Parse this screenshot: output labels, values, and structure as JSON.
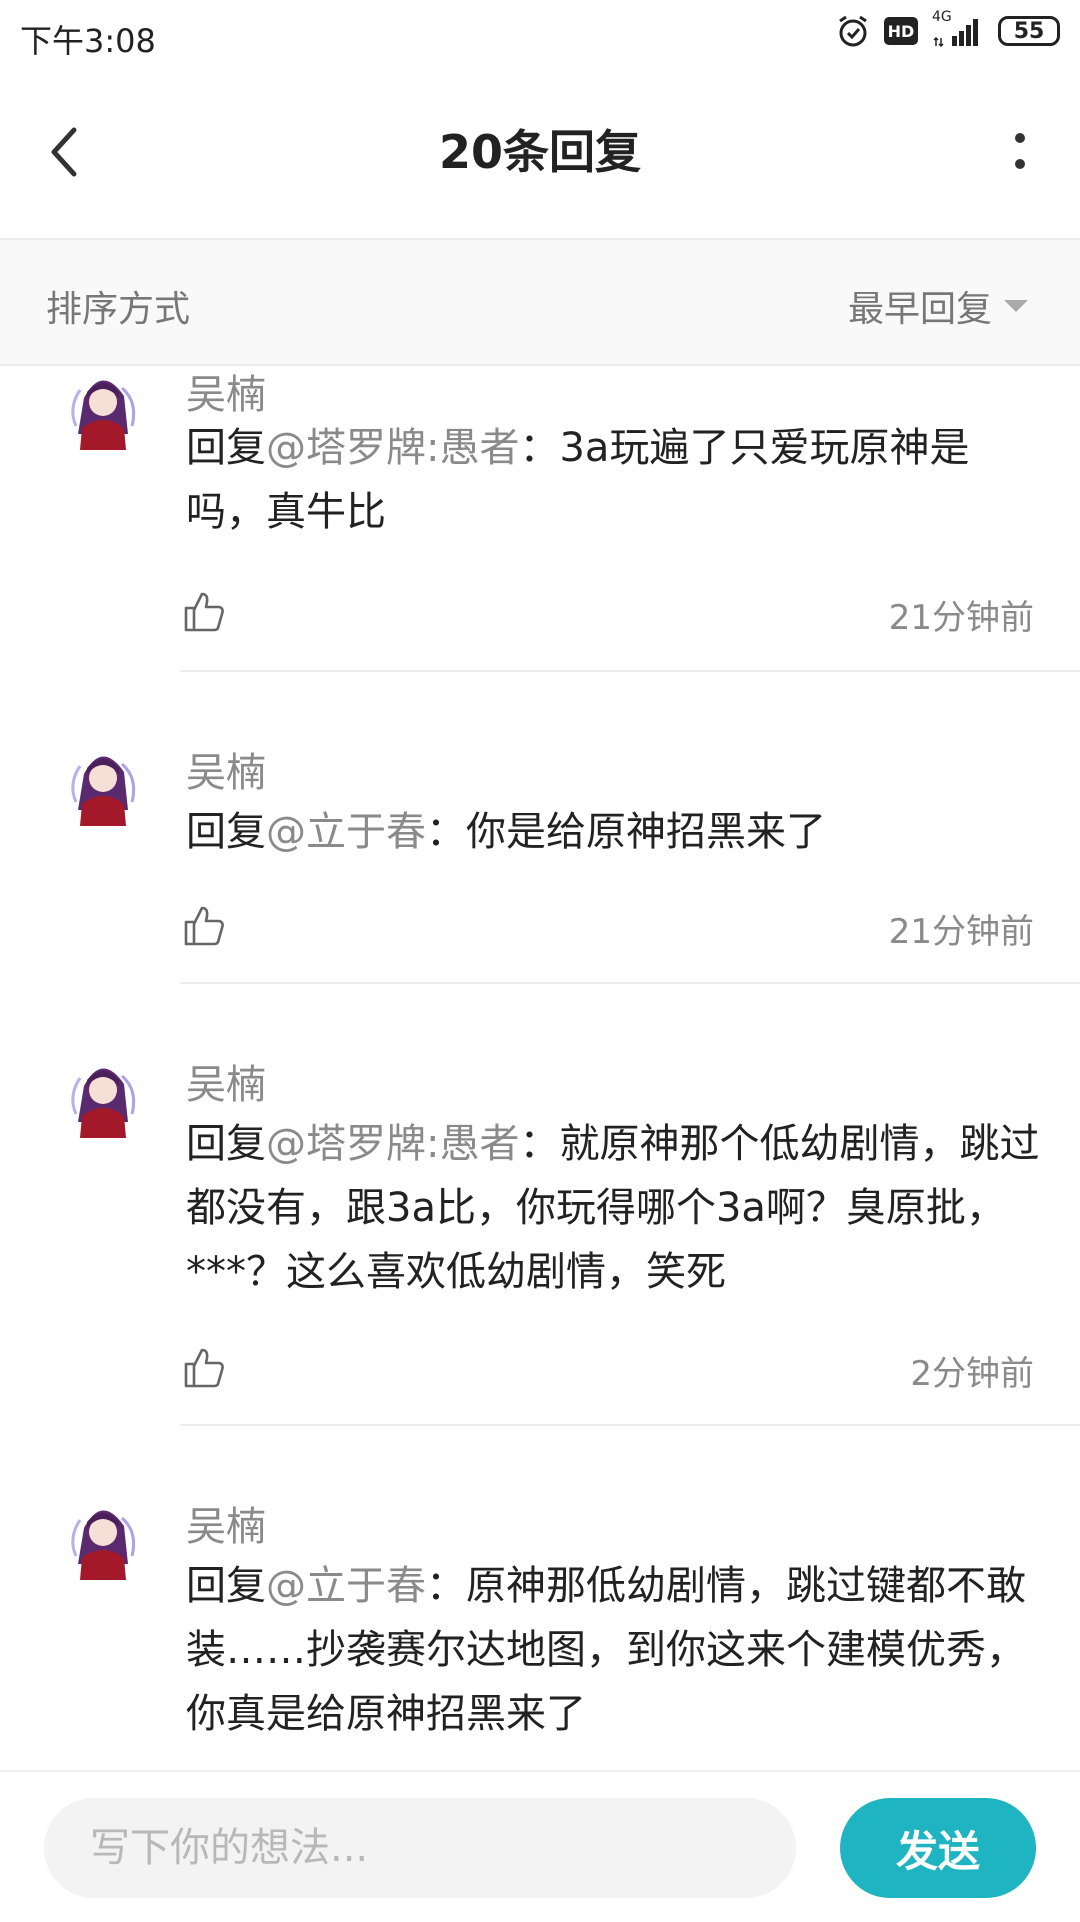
{
  "status_bar": {
    "time": "下午3:08",
    "hd": "HD",
    "network": "4G",
    "battery": "55"
  },
  "header": {
    "title": "20条回复"
  },
  "sort": {
    "label": "排序方式",
    "value": "最早回复"
  },
  "comments": [
    {
      "user": "吴楠",
      "prefix": "回复",
      "mention": "@塔罗牌:愚者",
      "body": "：3a玩遍了只爱玩原神是吗，真牛比",
      "time": "21分钟前"
    },
    {
      "user": "吴楠",
      "prefix": "回复",
      "mention": "@立于春",
      "body": "：你是给原神招黑来了",
      "time": "21分钟前"
    },
    {
      "user": "吴楠",
      "prefix": "回复",
      "mention": "@塔罗牌:愚者",
      "body": "：就原神那个低幼剧情，跳过都没有，跟3a比，你玩得哪个3a啊？臭原批，***？这么喜欢低幼剧情，笑死",
      "time": "2分钟前"
    },
    {
      "user": "吴楠",
      "prefix": "回复",
      "mention": "@立于春",
      "body": "：原神那低幼剧情，跳过键都不敢装……抄袭赛尔达地图，到你这来个建模优秀，你真是给原神招黑来了",
      "time": ""
    }
  ],
  "composer": {
    "placeholder": "写下你的想法...",
    "send_label": "发送"
  },
  "colors": {
    "accent": "#1fb4c1",
    "muted": "#8a8a8a"
  }
}
